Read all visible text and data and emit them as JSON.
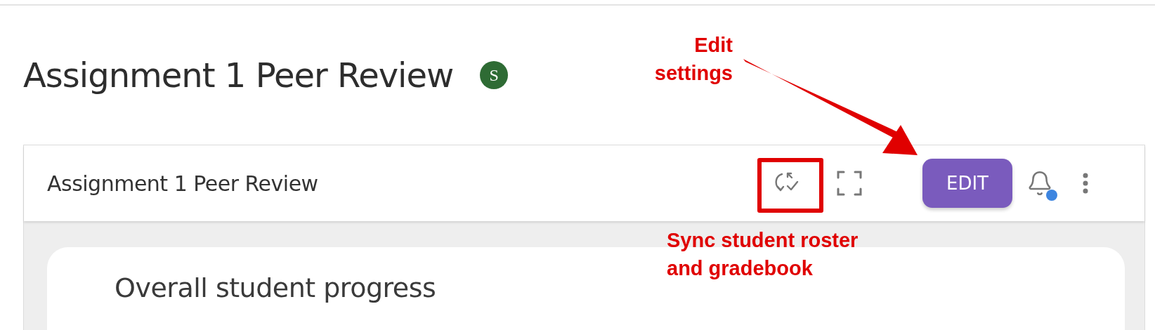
{
  "page_title": "Assignment 1 Peer Review",
  "status_badge": {
    "letter": "S"
  },
  "panel": {
    "title": "Assignment 1 Peer Review",
    "edit_button": "EDIT",
    "notification_dot": true,
    "card": {
      "title": "Overall student progress"
    }
  },
  "annotations": [
    {
      "kind": "arrow",
      "text": "Edit settings"
    },
    {
      "kind": "box",
      "text": "Sync student roster and gradebook"
    }
  ]
}
